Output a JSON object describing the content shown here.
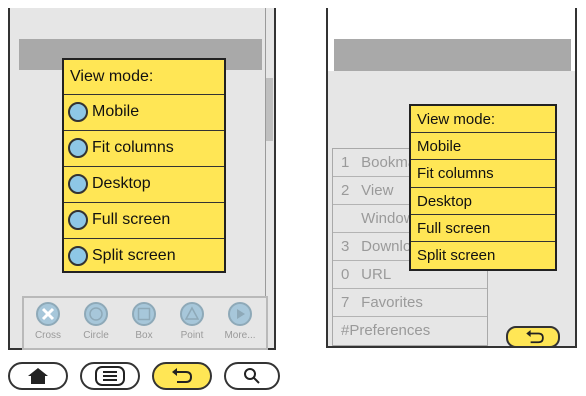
{
  "left_screen": {
    "popup": {
      "title": "View mode:",
      "options": [
        "Mobile",
        "Fit columns",
        "Desktop",
        "Full screen",
        "Split screen"
      ]
    },
    "toolbar": {
      "tools": [
        {
          "label": "Cross",
          "icon": "cross-icon"
        },
        {
          "label": "Circle",
          "icon": "circle-icon"
        },
        {
          "label": "Box",
          "icon": "box-icon"
        },
        {
          "label": "Point",
          "icon": "triangle-icon"
        },
        {
          "label": "More...",
          "icon": "play-icon"
        }
      ]
    }
  },
  "bottom_buttons": [
    {
      "name": "home",
      "icon": "home-icon"
    },
    {
      "name": "menu",
      "icon": "menu-icon"
    },
    {
      "name": "back",
      "icon": "back-arrow-icon"
    },
    {
      "name": "search",
      "icon": "search-icon"
    }
  ],
  "right_screen": {
    "menu_items": [
      {
        "num": "1",
        "label": "Bookmarks"
      },
      {
        "num": "2",
        "label": "View"
      },
      {
        "num": "",
        "label": "Windows"
      },
      {
        "num": "3",
        "label": "Downloads"
      },
      {
        "num": "0",
        "label": "URL"
      },
      {
        "num": "7",
        "label": "Favorites"
      },
      {
        "num": "#",
        "label": "Preferences"
      }
    ],
    "popup": {
      "title": "View mode:",
      "options": [
        "Mobile",
        "Fit columns",
        "Desktop",
        "Full screen",
        "Split screen"
      ]
    }
  },
  "colors": {
    "popup_yellow": "#ffe655",
    "radio_blue": "#8ec7e6",
    "screen_gray": "#e6e6e6",
    "bar_gray": "#a9a9a9"
  }
}
